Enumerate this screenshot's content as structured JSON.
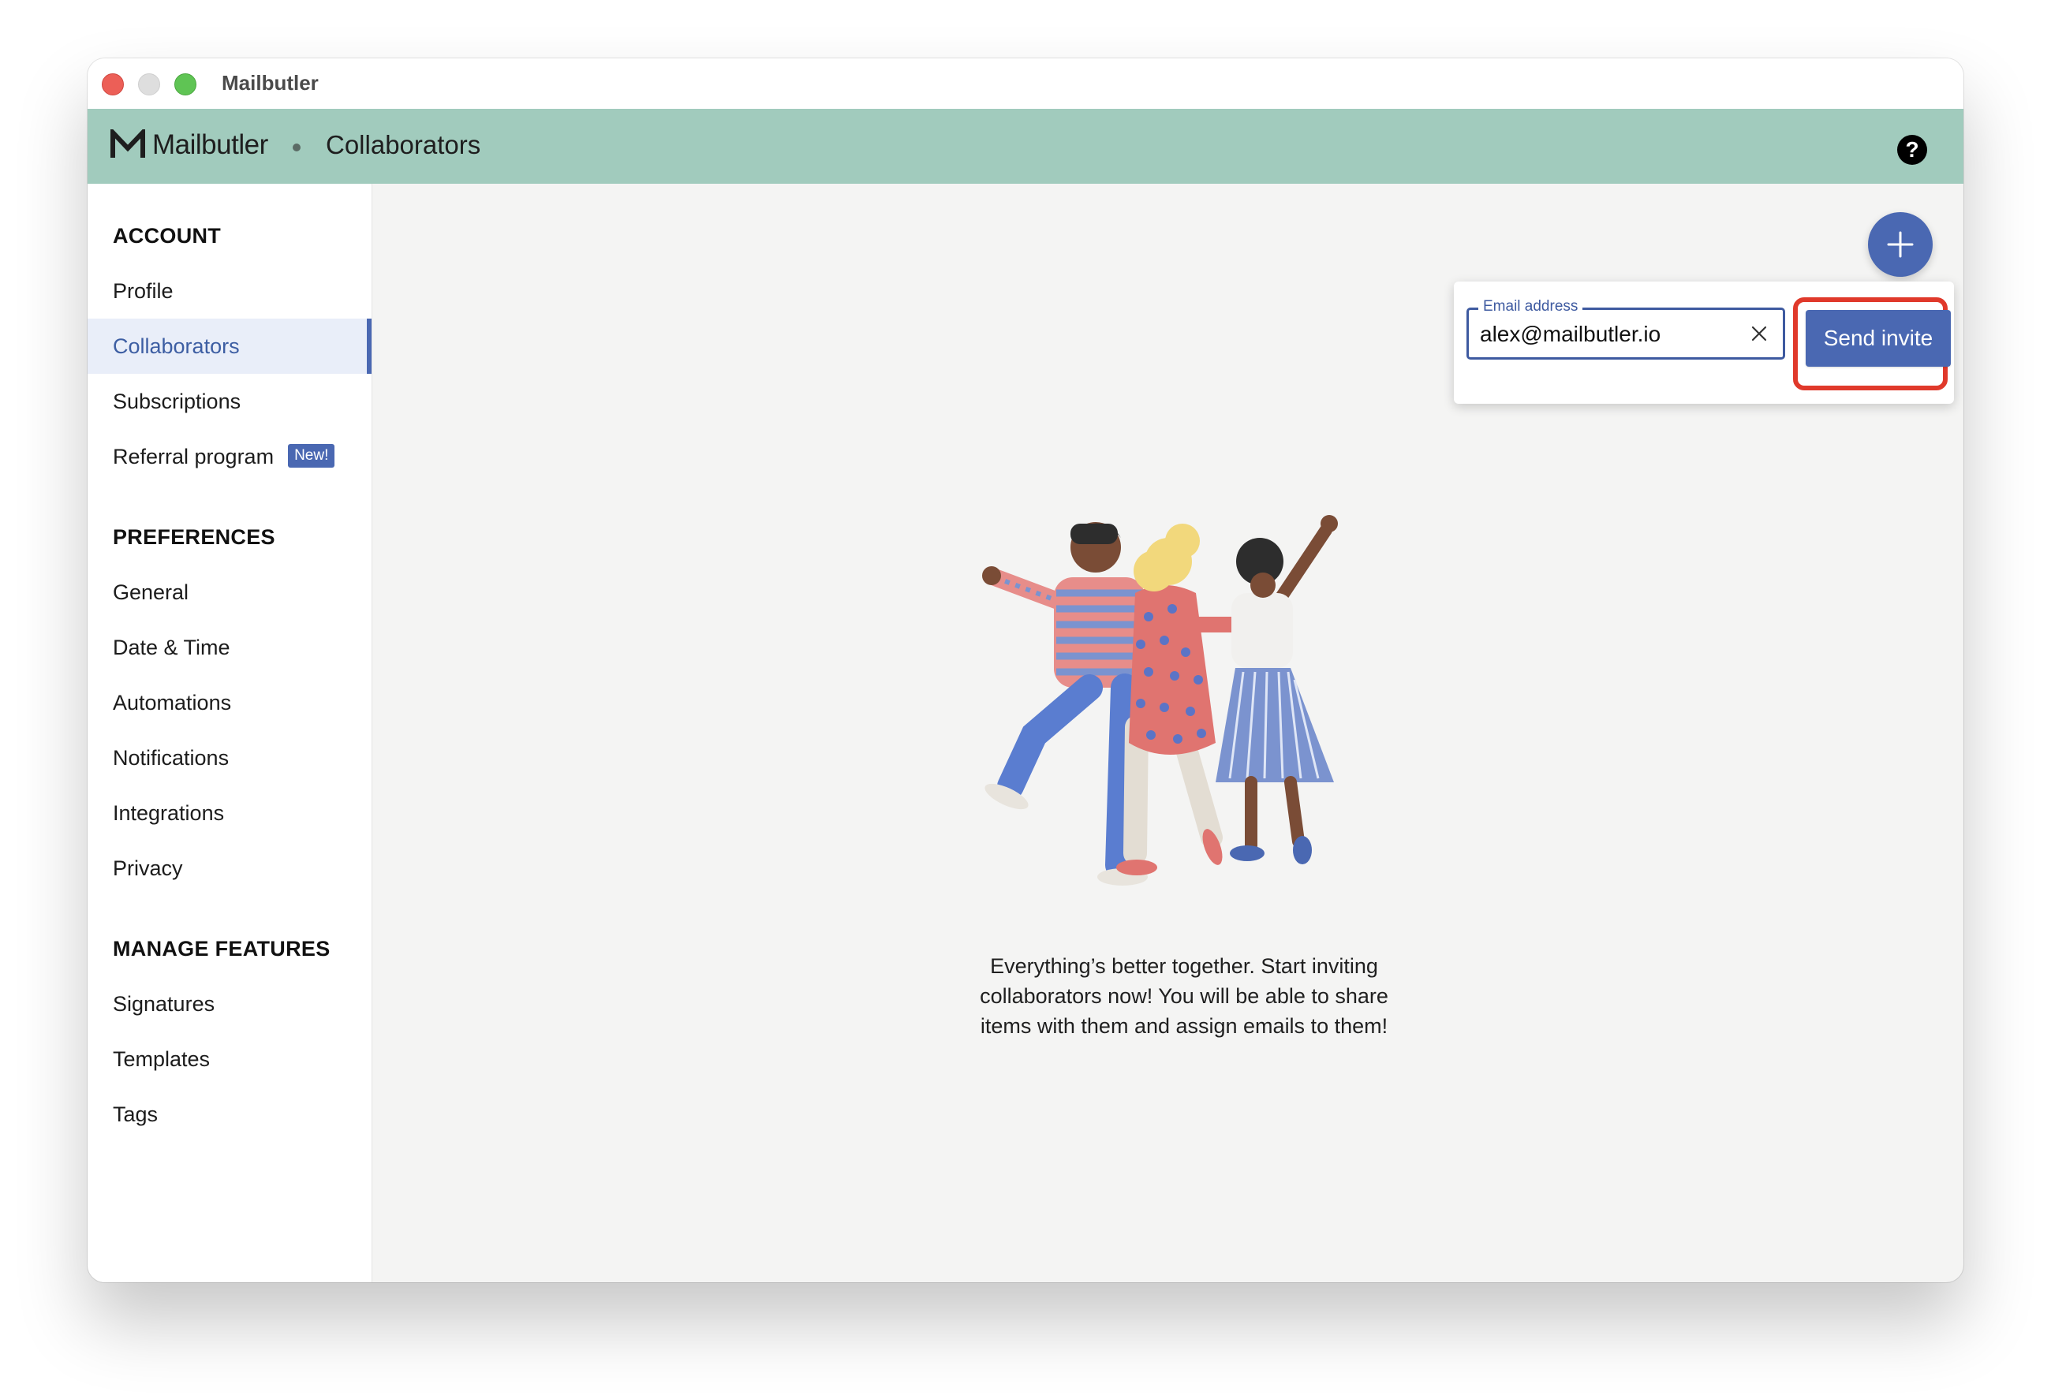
{
  "window": {
    "title": "Mailbutler"
  },
  "header": {
    "logo_text": "Mailbutler",
    "section": "Collaborators",
    "help_icon": "question-circle-icon"
  },
  "sidebar": {
    "sections": [
      {
        "heading": "ACCOUNT",
        "items": [
          {
            "label": "Profile"
          },
          {
            "label": "Collaborators",
            "active": true
          },
          {
            "label": "Subscriptions"
          },
          {
            "label": "Referral program",
            "badge": "New!"
          }
        ]
      },
      {
        "heading": "PREFERENCES",
        "items": [
          {
            "label": "General"
          },
          {
            "label": "Date & Time"
          },
          {
            "label": "Automations"
          },
          {
            "label": "Notifications"
          },
          {
            "label": "Integrations"
          },
          {
            "label": "Privacy"
          }
        ]
      },
      {
        "heading": "MANAGE FEATURES",
        "items": [
          {
            "label": "Signatures"
          },
          {
            "label": "Templates"
          },
          {
            "label": "Tags"
          }
        ]
      }
    ]
  },
  "invite": {
    "add_icon": "plus-icon",
    "email_label": "Email address",
    "email_value": "alex@mailbutler.io",
    "clear_icon": "close-icon",
    "send_label": "Send invite"
  },
  "empty_state": {
    "message": "Everything’s better together. Start inviting collaborators now! You will be able to share items with them and assign emails to them!"
  },
  "colors": {
    "header_bg": "#a1cbbd",
    "accent": "#4a68b2",
    "highlight_outline": "#e0392b",
    "active_nav_bg": "#e9eef9"
  }
}
